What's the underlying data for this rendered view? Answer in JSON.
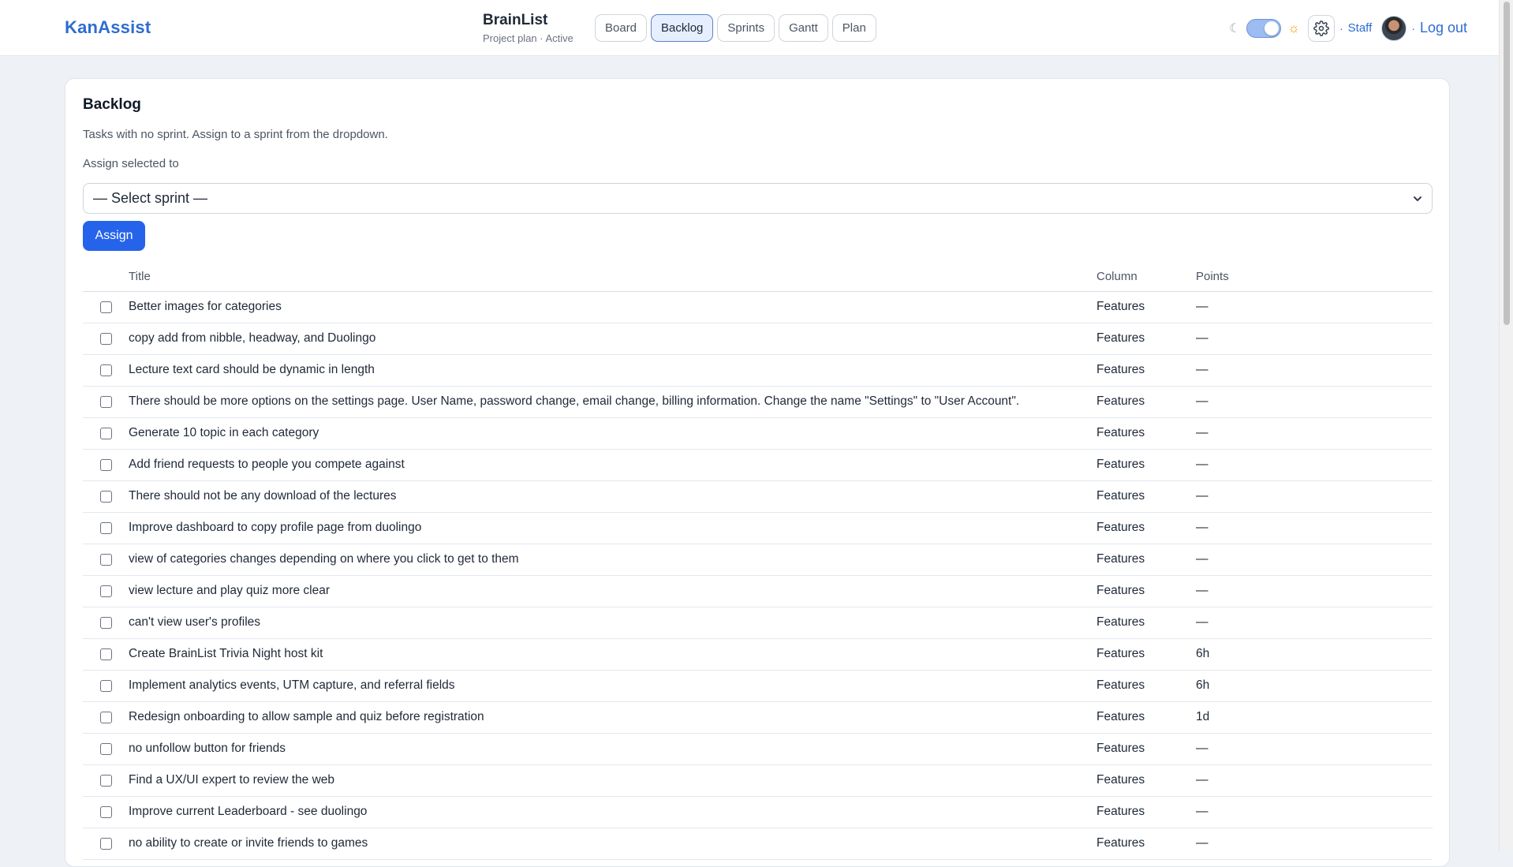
{
  "app": {
    "brand": "KanAssist"
  },
  "project": {
    "name": "BrainList",
    "meta": "Project plan · Active"
  },
  "nav": {
    "tabs": [
      {
        "label": "Board"
      },
      {
        "label": "Backlog"
      },
      {
        "label": "Sprints"
      },
      {
        "label": "Gantt"
      },
      {
        "label": "Plan"
      }
    ],
    "active": "Backlog"
  },
  "header_right": {
    "separator": "·",
    "staff_label": "Staff",
    "logout_label": "Log out",
    "theme_toggle_on": true
  },
  "backlog": {
    "title": "Backlog",
    "description": "Tasks with no sprint. Assign to a sprint from the dropdown.",
    "assign_label": "Assign selected to",
    "select_value": "— Select sprint —",
    "assign_button": "Assign"
  },
  "table": {
    "headers": {
      "title": "Title",
      "column": "Column",
      "points": "Points"
    },
    "rows": [
      {
        "title": "Better images for categories",
        "column": "Features",
        "points": "—"
      },
      {
        "title": "copy add from nibble, headway, and Duolingo",
        "column": "Features",
        "points": "—"
      },
      {
        "title": "Lecture text card should be dynamic in length",
        "column": "Features",
        "points": "—"
      },
      {
        "title": "There should be more options on the settings page. User Name, password change, email change, billing information. Change the name \"Settings\" to \"User Account\".",
        "column": "Features",
        "points": "—"
      },
      {
        "title": "Generate 10 topic in each category",
        "column": "Features",
        "points": "—"
      },
      {
        "title": "Add friend requests to people you compete against",
        "column": "Features",
        "points": "—"
      },
      {
        "title": "There should not be any download of the lectures",
        "column": "Features",
        "points": "—"
      },
      {
        "title": "Improve dashboard to copy profile page from duolingo",
        "column": "Features",
        "points": "—"
      },
      {
        "title": "view of categories changes depending on where you click to get to them",
        "column": "Features",
        "points": "—"
      },
      {
        "title": "view lecture and play quiz more clear",
        "column": "Features",
        "points": "—"
      },
      {
        "title": "can't view user's profiles",
        "column": "Features",
        "points": "—"
      },
      {
        "title": "Create BrainList Trivia Night host kit",
        "column": "Features",
        "points": "6h"
      },
      {
        "title": "Implement analytics events, UTM capture, and referral fields",
        "column": "Features",
        "points": "6h"
      },
      {
        "title": "Redesign onboarding to allow sample and quiz before registration",
        "column": "Features",
        "points": "1d"
      },
      {
        "title": "no unfollow button for friends",
        "column": "Features",
        "points": "—"
      },
      {
        "title": "Find a UX/UI expert to review the web",
        "column": "Features",
        "points": "—"
      },
      {
        "title": "Improve current Leaderboard - see duolingo",
        "column": "Features",
        "points": "—"
      },
      {
        "title": "no ability to create or invite friends to games",
        "column": "Features",
        "points": "—"
      }
    ]
  },
  "colors": {
    "brand": "#2f6bd3",
    "primary_button": "#2563eb",
    "active_tab_bg": "#e6efff",
    "sun": "#f59e0b"
  },
  "icons": [
    "moon-icon",
    "sun-icon",
    "gear-icon",
    "chevron-down-icon"
  ]
}
